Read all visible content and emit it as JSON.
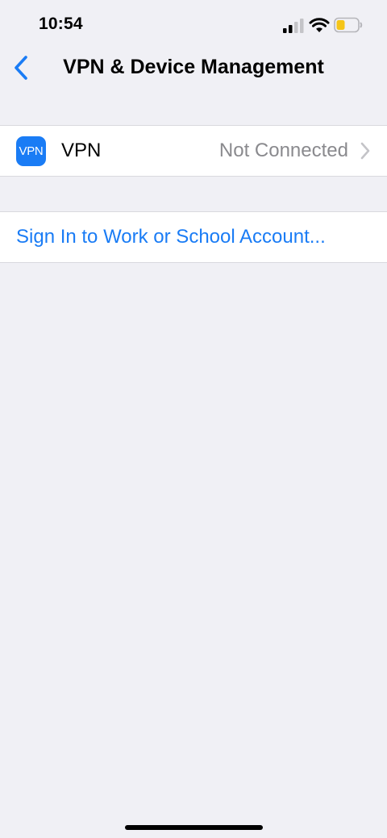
{
  "status_bar": {
    "time": "10:54",
    "signal_icon": "cellular-signal-icon",
    "wifi_icon": "wifi-icon",
    "battery_icon": "battery-low-icon",
    "battery_color": "#f5c518"
  },
  "nav": {
    "back_icon": "chevron-left-icon",
    "title": "VPN & Device Management"
  },
  "vpn_row": {
    "icon_text": "VPN",
    "label": "VPN",
    "status": "Not Connected",
    "accent": "#1a7cf5"
  },
  "account": {
    "sign_in_label": "Sign In to Work or School Account..."
  },
  "colors": {
    "background": "#f0f0f5",
    "link": "#1a7cf5",
    "secondary_text": "#8a8a8e"
  }
}
